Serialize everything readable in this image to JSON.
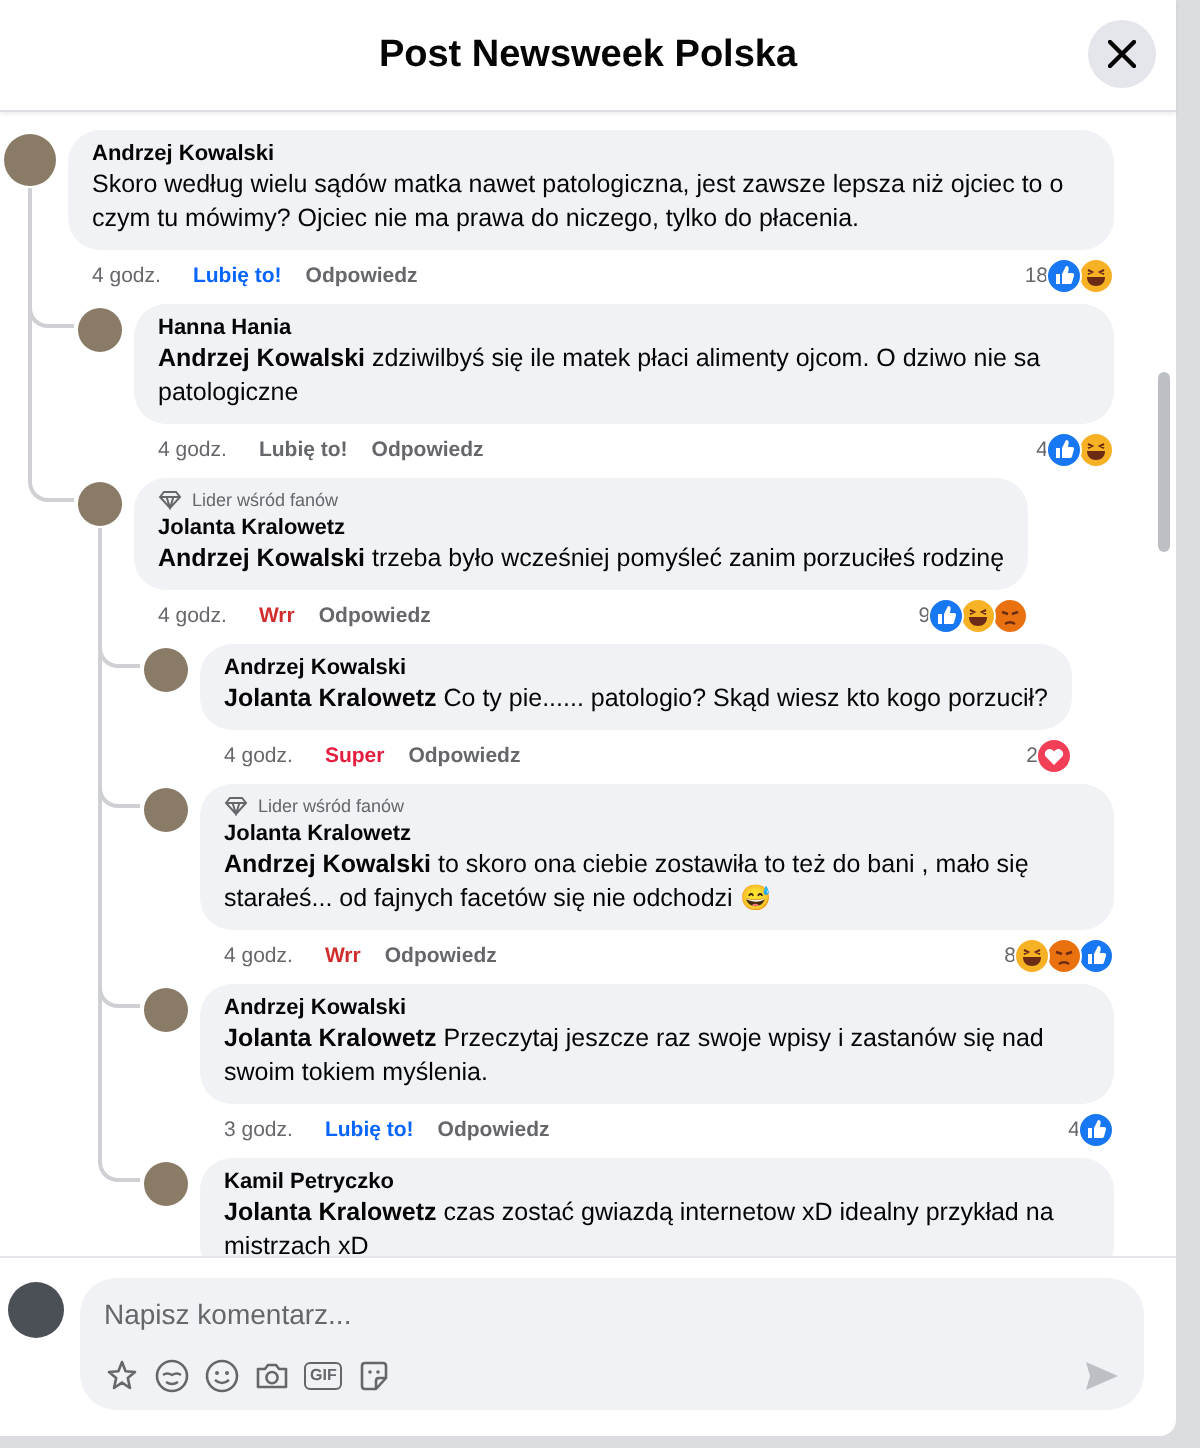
{
  "window": {
    "title": "Post Newsweek Polska"
  },
  "comments": [
    {
      "author": "Andrzej Kowalski",
      "text": "Skoro według wielu sądów matka nawet patologiczna, jest zawsze lepsza niż ojciec to o czym tu mówimy? Ojciec nie ma prawa do niczego, tylko do płacenia.",
      "meta": {
        "time": "4 godz.",
        "reaction_label": "Lubię to!",
        "reacted": true,
        "color": "#0866ff",
        "reply": "Odpowiedz",
        "count": "18",
        "reactions": [
          {
            "kind": "like"
          },
          {
            "kind": "haha"
          }
        ]
      },
      "children": [
        {
          "author": "Hanna Hania",
          "text": "**Andrzej Kowalski** zdziwilbyś się ile matek płaci alimenty ojcom. O dziwo nie sa patologiczne",
          "meta": {
            "time": "4 godz.",
            "reaction_label": "Lubię to!",
            "reacted": false,
            "reply": "Odpowiedz",
            "count": "4",
            "reactions": [
              {
                "kind": "like"
              },
              {
                "kind": "haha"
              }
            ]
          }
        },
        {
          "author": "Jolanta Kralowetz",
          "badge": "Lider wśród fanów",
          "text": "**Andrzej Kowalski** trzeba było wcześniej pomyśleć zanim porzuciłeś rodzinę",
          "meta": {
            "time": "4 godz.",
            "reaction_label": "Wrr",
            "reacted": true,
            "color": "#d12d2d",
            "reply": "Odpowiedz",
            "count": "9",
            "reactions": [
              {
                "kind": "like"
              },
              {
                "kind": "haha"
              },
              {
                "kind": "angry"
              }
            ]
          },
          "children": [
            {
              "author": "Andrzej Kowalski",
              "text": "**Jolanta Kralowetz** Co ty pie...... patologio? Skąd wiesz kto kogo porzucił?",
              "meta": {
                "time": "4 godz.",
                "reaction_label": "Super",
                "reacted": true,
                "color": "#e41e3f",
                "reply": "Odpowiedz",
                "count": "2",
                "reactions": [
                  {
                    "kind": "love"
                  }
                ]
              }
            },
            {
              "author": "Jolanta Kralowetz",
              "badge": "Lider wśród fanów",
              "text": "**Andrzej Kowalski** to skoro ona ciebie zostawiła to też do bani , mało się starałeś... od fajnych facetów się nie odchodzi 😅",
              "meta": {
                "time": "4 godz.",
                "reaction_label": "Wrr",
                "reacted": true,
                "color": "#d12d2d",
                "reply": "Odpowiedz",
                "count": "8",
                "reactions": [
                  {
                    "kind": "haha"
                  },
                  {
                    "kind": "angry"
                  },
                  {
                    "kind": "like"
                  }
                ]
              }
            },
            {
              "author": "Andrzej Kowalski",
              "text": "**Jolanta Kralowetz** Przeczytaj jeszcze raz swoje wpisy i zastanów się nad swoim tokiem myślenia.",
              "meta": {
                "time": "3 godz.",
                "reaction_label": "Lubię to!",
                "reacted": true,
                "color": "#0866ff",
                "reply": "Odpowiedz",
                "count": "4",
                "reactions": [
                  {
                    "kind": "like"
                  }
                ]
              }
            },
            {
              "author": "Kamil Petryczko",
              "text": "**Jolanta Kralowetz** czas zostać gwiazdą internetow xD idealny przykład na mistrzach xD"
            }
          ]
        }
      ]
    }
  ],
  "composer": {
    "placeholder": "Napisz komentarz...",
    "tools": [
      {
        "kind": "sparkle"
      },
      {
        "kind": "avatar"
      },
      {
        "kind": "smiley"
      },
      {
        "kind": "camera"
      },
      {
        "kind": "gif",
        "label": "GIF"
      },
      {
        "kind": "sticker"
      }
    ]
  }
}
